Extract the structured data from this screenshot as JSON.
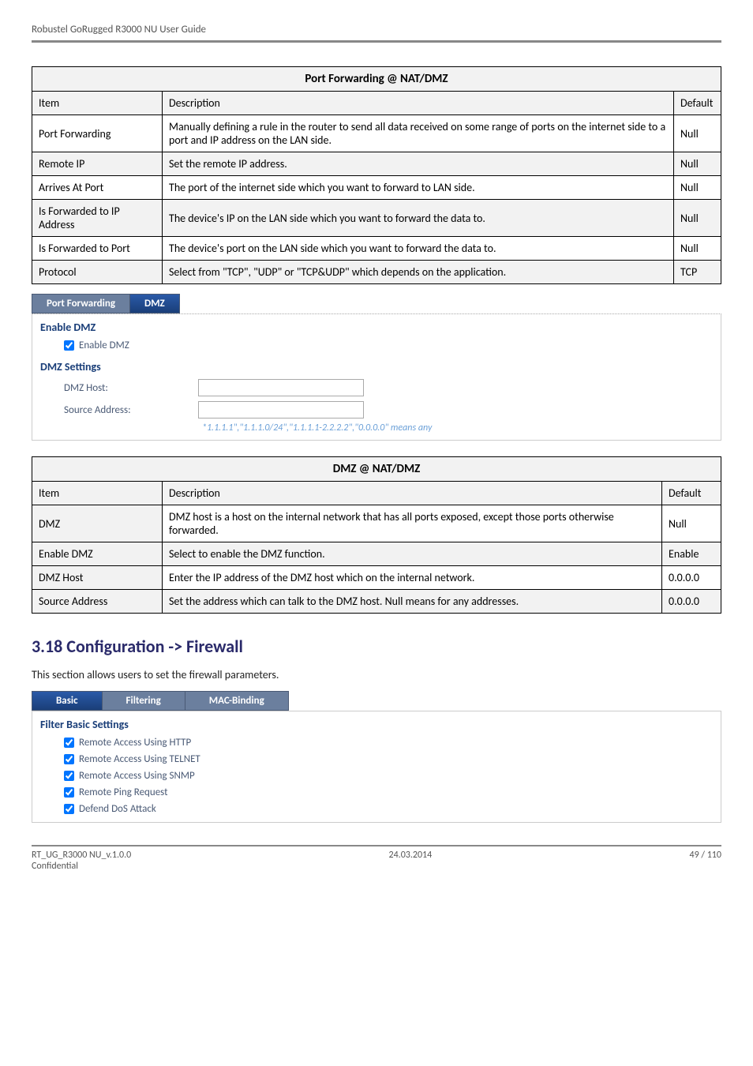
{
  "header": "Robustel GoRugged R3000 NU User Guide",
  "table1": {
    "title": "Port Forwarding @ NAT/DMZ",
    "cols": {
      "item": "Item",
      "desc": "Description",
      "def": "Default"
    },
    "rows": [
      {
        "item": "Port Forwarding",
        "desc": "Manually defining a rule in the router to send all data received on some range of ports on the internet side to a port and IP address on the LAN side.",
        "def": "Null"
      },
      {
        "item": "Remote IP",
        "desc": "Set the remote IP address.",
        "def": "Null"
      },
      {
        "item": "Arrives At Port",
        "desc": "The port of the internet side which you want to forward to LAN side.",
        "def": "Null"
      },
      {
        "item": "Is Forwarded to IP Address",
        "desc": "The device's IP on the LAN side which you want to forward the data to.",
        "def": "Null"
      },
      {
        "item": "Is Forwarded to Port",
        "desc": "The device's port on the LAN side which you want to forward the data to.",
        "def": "Null"
      },
      {
        "item": "Protocol",
        "desc": "Select from \"TCP\", \"UDP\" or \"TCP&UDP\" which depends on the application.",
        "def": "TCP"
      }
    ]
  },
  "tabs1": {
    "left": "Port Forwarding",
    "right": "DMZ"
  },
  "dmzPanel": {
    "enable_header": "Enable DMZ",
    "enable_label": "Enable DMZ",
    "settings_header": "DMZ Settings",
    "host_label": "DMZ Host:",
    "source_label": "Source Address:",
    "hint": "*1.1.1.1\",\"1.1.1.0/24\",\"1.1.1.1-2.2.2.2\",\"0.0.0.0\" means any"
  },
  "table2": {
    "title": "DMZ @ NAT/DMZ",
    "cols": {
      "item": "Item",
      "desc": "Description",
      "def": "Default"
    },
    "rows": [
      {
        "item": "DMZ",
        "desc": "DMZ host is a host on the internal network that has all ports exposed, except those ports otherwise forwarded.",
        "def": "Null"
      },
      {
        "item": "Enable DMZ",
        "desc": "Select to enable the DMZ function.",
        "def": "Enable"
      },
      {
        "item": "DMZ Host",
        "desc": "Enter the IP address of the DMZ host which on the internal network.",
        "def": "0.0.0.0"
      },
      {
        "item": "Source Address",
        "desc": "Set the address which can talk to the DMZ host. Null means for any addresses.",
        "def": "0.0.0.0"
      }
    ]
  },
  "heading": "3.18  Configuration -> Firewall",
  "bodyText": "This section allows users to set the firewall parameters.",
  "tabs2": {
    "a": "Basic",
    "b": "Filtering",
    "c": "MAC-Binding"
  },
  "filterPanel": {
    "header": "Filter Basic Settings",
    "items": [
      "Remote Access Using HTTP",
      "Remote Access Using TELNET",
      "Remote Access Using SNMP",
      "Remote Ping Request",
      "Defend DoS Attack"
    ]
  },
  "footer": {
    "left": "RT_UG_R3000 NU_v.1.0.0\nConfidential",
    "center": "24.03.2014",
    "right": "49 / 110"
  }
}
